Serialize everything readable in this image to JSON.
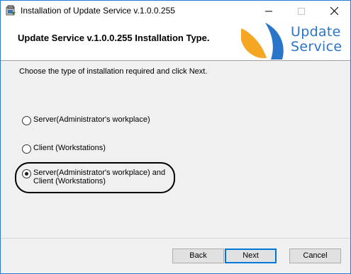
{
  "window": {
    "title": "Installation of Update Service v.1.0.0.255"
  },
  "header": {
    "title": "Update Service v.1.0.0.255 Installation Type.",
    "logo_line1": "Update",
    "logo_line2": "Service",
    "brand_blue": "#2a74c9",
    "brand_orange": "#f5a623"
  },
  "main": {
    "instruction": "Choose the type of installation required and click Next.",
    "options": [
      {
        "label": "Server(Administrator's workplace)",
        "selected": false
      },
      {
        "label": "Client (Workstations)",
        "selected": false
      },
      {
        "label": "Server(Administrator's workplace) and Client (Workstations)",
        "selected": true
      }
    ]
  },
  "footer": {
    "back_label": "Back",
    "next_label": "Next",
    "cancel_label": "Cancel"
  }
}
